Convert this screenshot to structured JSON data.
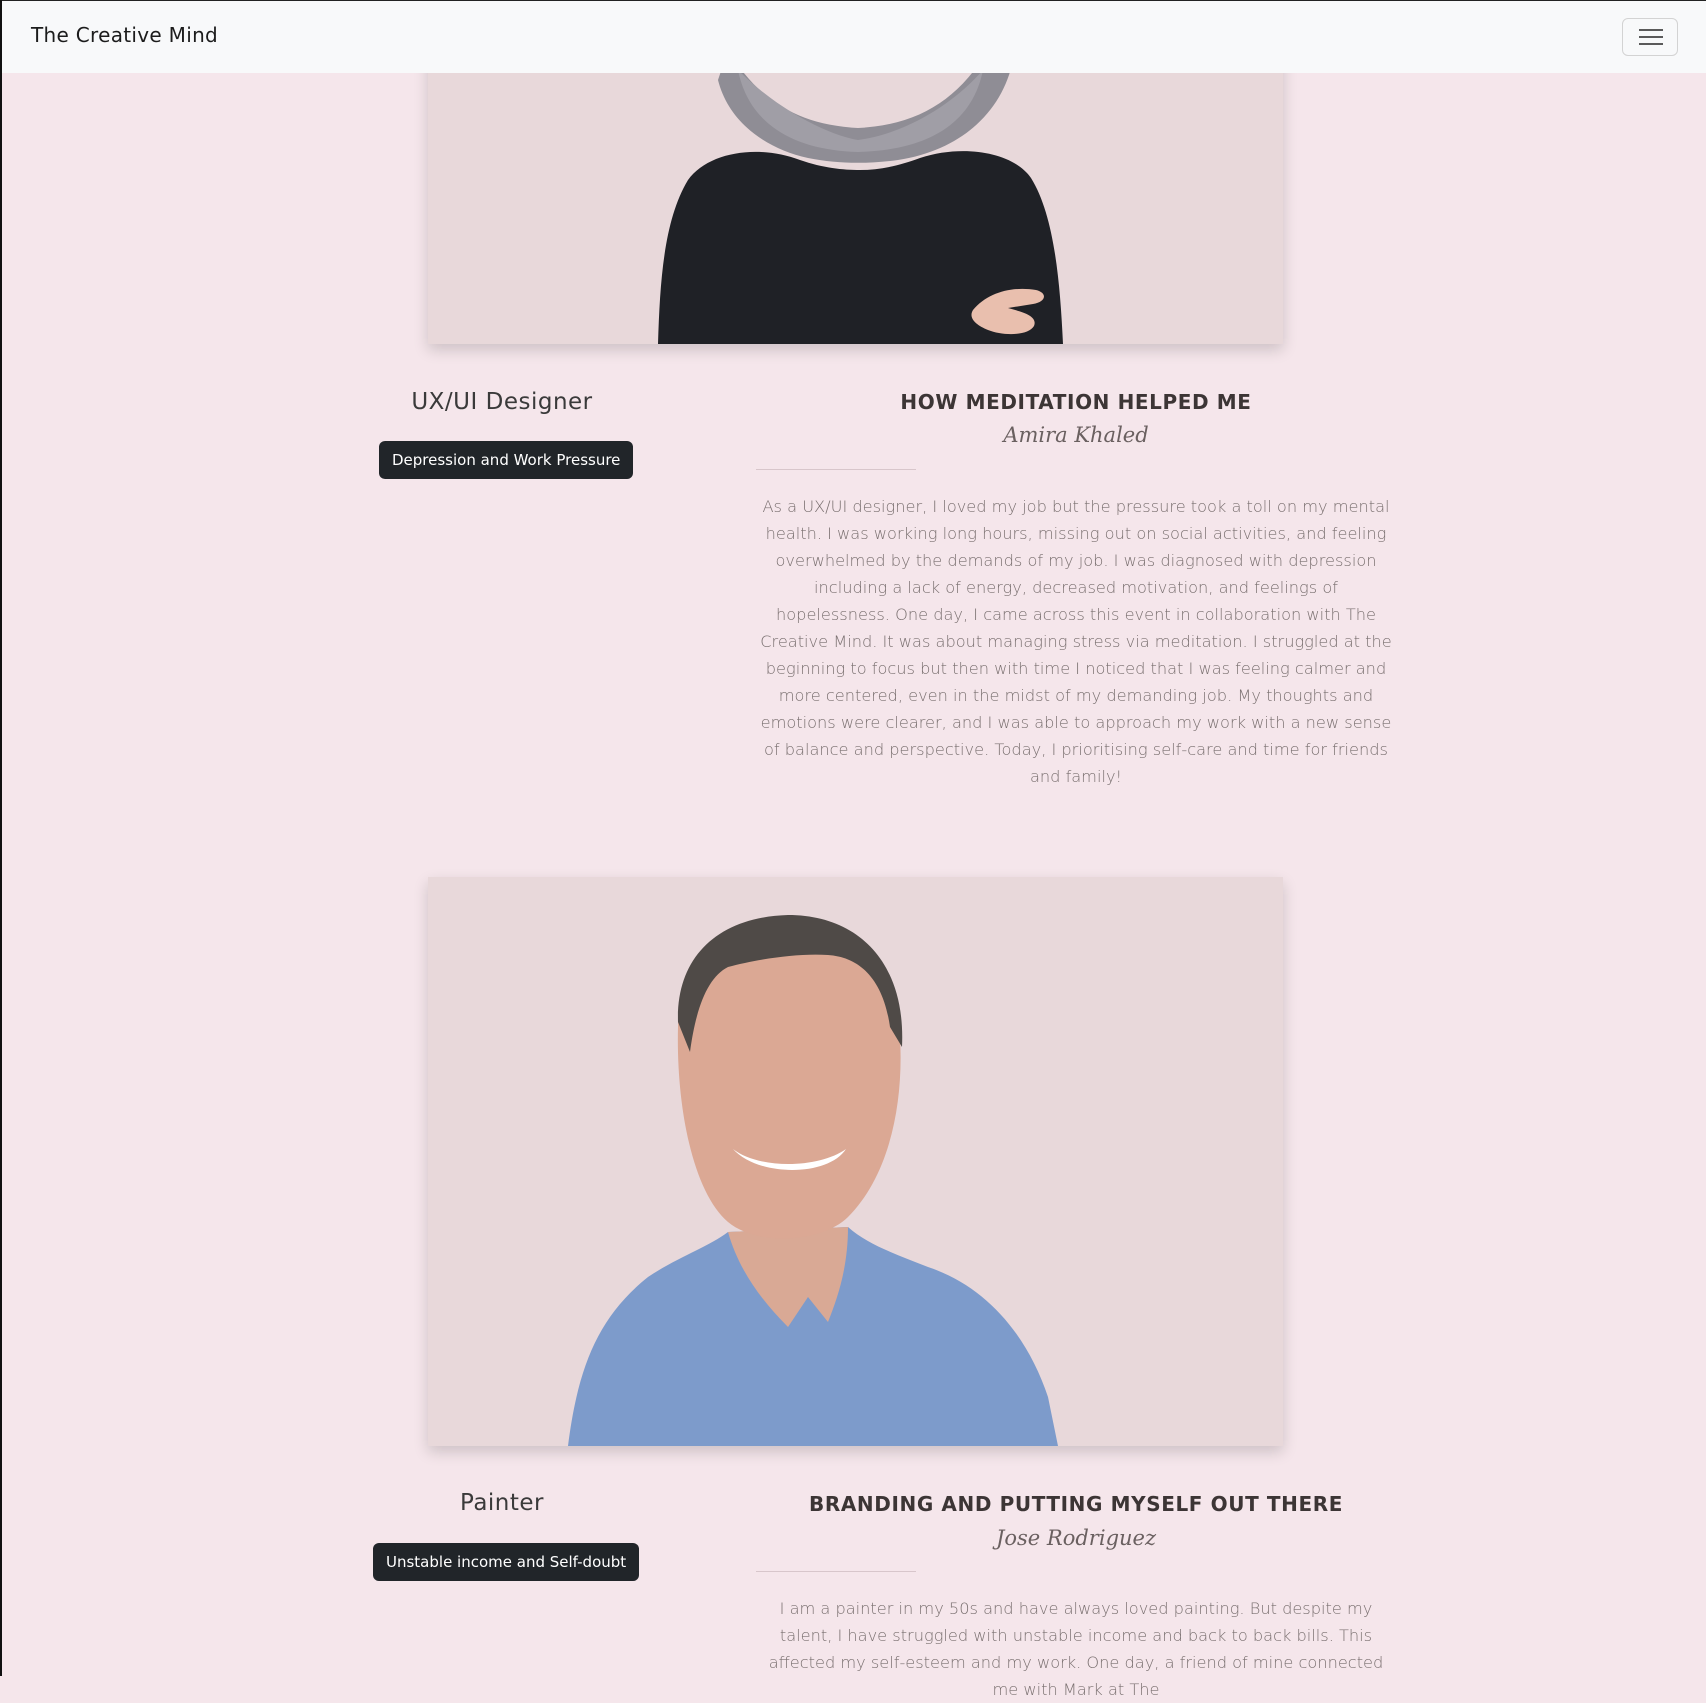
{
  "navbar": {
    "brand": "The Creative Mind",
    "menu_icon": "hamburger-menu-icon"
  },
  "stories": [
    {
      "photo_alt": "Woman in grey hijab and black sweater",
      "role": "UX/UI Designer",
      "badge": "Depression and Work Pressure",
      "title": "HOW MEDITATION HELPED ME",
      "author": "Amira Khaled",
      "text": "As a UX/UI designer, I loved my job but the pressure took a toll on my mental health. I was working long hours, missing out on social activities, and feeling overwhelmed by the demands of my job. I was diagnosed with depression including a lack of energy, decreased motivation, and feelings of hopelessness. One day, I came across this event in collaboration with The Creative Mind. It was about managing stress via meditation. I struggled at the beginning to focus but then with time I noticed that I was feeling calmer and more centered, even in the midst of my demanding job. My thoughts and emotions were clearer, and I was able to approach my work with a new sense of balance and perspective. Today, I prioritising self-care and time for friends and family!"
    },
    {
      "photo_alt": "Smiling man in blue shirt",
      "role": "Painter",
      "badge": "Unstable income and Self-doubt",
      "title": "BRANDING AND PUTTING MYSELF OUT THERE",
      "author": "Jose Rodriguez",
      "text": "I am a painter in my 50s and have always loved painting. But despite my talent, I have struggled with unstable income and back to back bills. This affected my self-esteem and my work. One day, a friend of mine connected me with Mark at The"
    }
  ],
  "colors": {
    "page_background": "#f5e6eb",
    "navbar_background": "#f8f9fa",
    "badge_background": "#212529",
    "photo_background": "#e8d8da"
  }
}
